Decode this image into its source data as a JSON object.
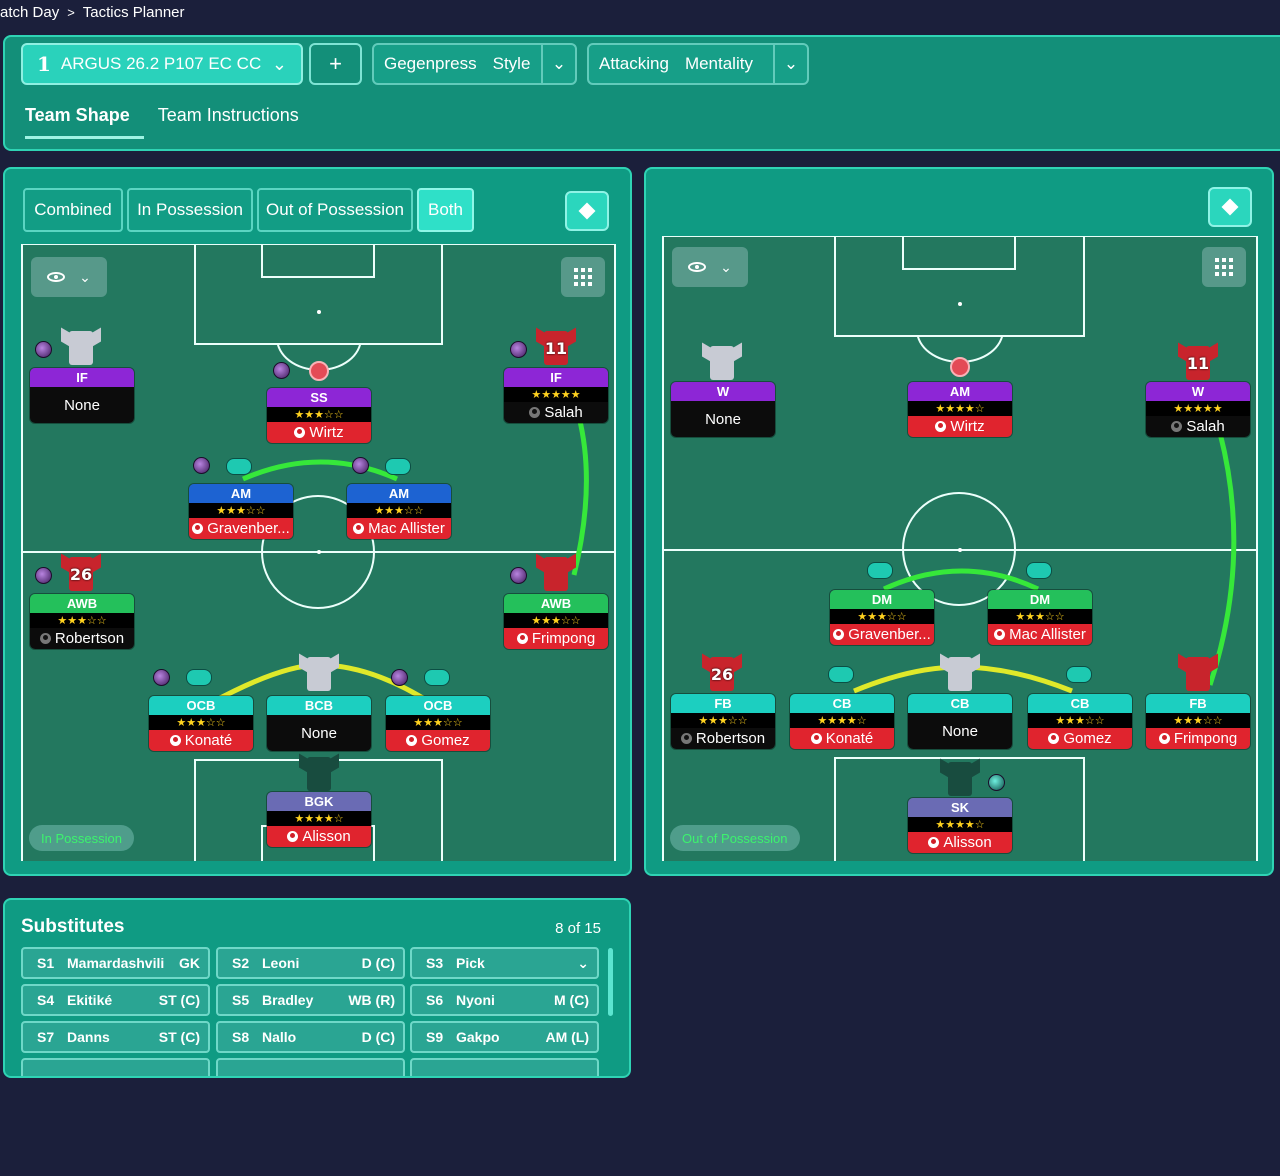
{
  "breadcrumb": {
    "parent": "atch Day",
    "current": "Tactics Planner"
  },
  "header": {
    "tactic_number": "1",
    "tactic_name": "ARGUS 26.2 P107 EC CC",
    "add_label": "+",
    "style_value": "Gegenpress",
    "style_label": "Style",
    "mentality_value": "Attacking",
    "mentality_label": "Mentality",
    "tabs": [
      {
        "label": "Team Shape"
      },
      {
        "label": "Team Instructions"
      }
    ]
  },
  "modes": [
    {
      "label": "Combined"
    },
    {
      "label": "In Possession"
    },
    {
      "label": "Out of Possession"
    },
    {
      "label": "Both"
    }
  ],
  "left_pitch": {
    "label": "In Possession",
    "players": [
      {
        "role": "IF",
        "stars": "",
        "name": "None",
        "kit": ""
      },
      {
        "role": "SS",
        "stars": "★★★☆☆",
        "name": "Wirtz",
        "kit": ""
      },
      {
        "role": "IF",
        "stars": "★★★★★",
        "name": "Salah",
        "kit": "11"
      },
      {
        "role": "AM",
        "stars": "★★★☆☆",
        "name": "Gravenber...",
        "kit": ""
      },
      {
        "role": "AM",
        "stars": "★★★☆☆",
        "name": "Mac Allister",
        "kit": ""
      },
      {
        "role": "AWB",
        "stars": "★★★☆☆",
        "name": "Robertson",
        "kit": "26"
      },
      {
        "role": "AWB",
        "stars": "★★★☆☆",
        "name": "Frimpong",
        "kit": ""
      },
      {
        "role": "OCB",
        "stars": "★★★☆☆",
        "name": "Konaté",
        "kit": ""
      },
      {
        "role": "BCB",
        "stars": "",
        "name": "None",
        "kit": ""
      },
      {
        "role": "OCB",
        "stars": "★★★☆☆",
        "name": "Gomez",
        "kit": ""
      },
      {
        "role": "BGK",
        "stars": "★★★★☆",
        "name": "Alisson",
        "kit": ""
      }
    ]
  },
  "right_pitch": {
    "label": "Out of Possession",
    "players": [
      {
        "role": "W",
        "stars": "",
        "name": "None",
        "kit": ""
      },
      {
        "role": "AM",
        "stars": "★★★★☆",
        "name": "Wirtz",
        "kit": ""
      },
      {
        "role": "W",
        "stars": "★★★★★",
        "name": "Salah",
        "kit": "11"
      },
      {
        "role": "DM",
        "stars": "★★★☆☆",
        "name": "Gravenber...",
        "kit": ""
      },
      {
        "role": "DM",
        "stars": "★★★☆☆",
        "name": "Mac Allister",
        "kit": ""
      },
      {
        "role": "FB",
        "stars": "★★★☆☆",
        "name": "Robertson",
        "kit": "26"
      },
      {
        "role": "CB",
        "stars": "★★★★☆",
        "name": "Konaté",
        "kit": ""
      },
      {
        "role": "CB",
        "stars": "",
        "name": "None",
        "kit": ""
      },
      {
        "role": "CB",
        "stars": "★★★☆☆",
        "name": "Gomez",
        "kit": ""
      },
      {
        "role": "FB",
        "stars": "★★★☆☆",
        "name": "Frimpong",
        "kit": ""
      },
      {
        "role": "SK",
        "stars": "★★★★☆",
        "name": "Alisson",
        "kit": ""
      }
    ]
  },
  "substitutes": {
    "title": "Substitutes",
    "count": "8 of 15",
    "items": [
      {
        "code": "S1",
        "name": "Mamardashvili",
        "pos": "GK"
      },
      {
        "code": "S2",
        "name": "Leoni",
        "pos": "D (C)"
      },
      {
        "code": "S3",
        "name": "Pick",
        "pos": ""
      },
      {
        "code": "S4",
        "name": "Ekitiké",
        "pos": "ST (C)"
      },
      {
        "code": "S5",
        "name": "Bradley",
        "pos": "WB (R)"
      },
      {
        "code": "S6",
        "name": "Nyoni",
        "pos": "M (C)"
      },
      {
        "code": "S7",
        "name": "Danns",
        "pos": "ST (C)"
      },
      {
        "code": "S8",
        "name": "Nallo",
        "pos": "D (C)"
      },
      {
        "code": "S9",
        "name": "Gakpo",
        "pos": "AM (L)"
      }
    ]
  },
  "icons": {
    "chevron": "chevron-down-icon",
    "eye": "eye-icon",
    "grid": "grid-icon",
    "diamond": "diamond-icon"
  }
}
